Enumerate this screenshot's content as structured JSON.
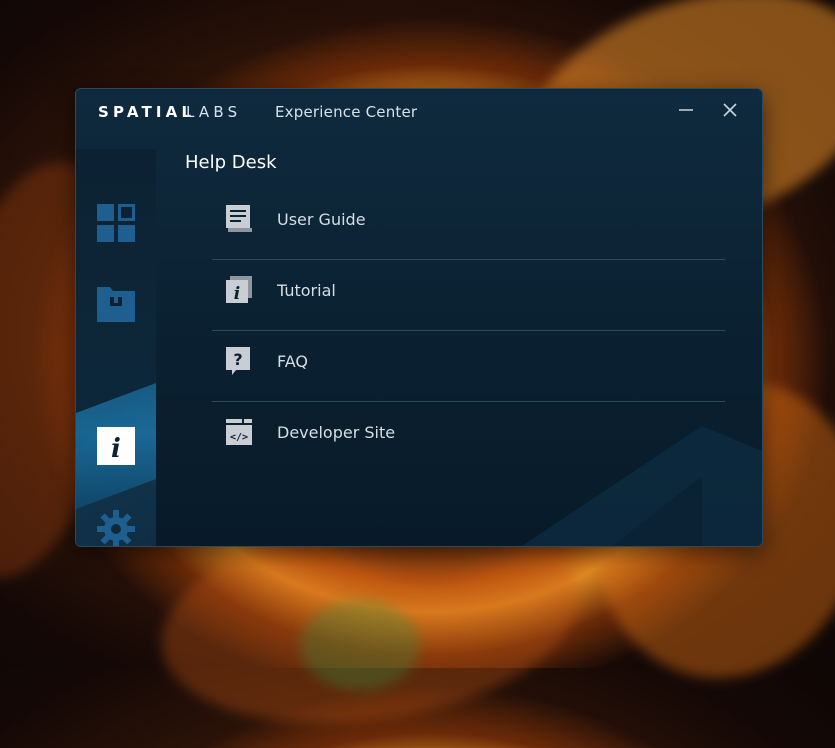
{
  "window": {
    "brand_strong": "SPATIAL",
    "brand_light": "LABS",
    "app_title": "Experience Center",
    "minimize_icon": "minimize-icon",
    "close_icon": "close-icon"
  },
  "sidebar": {
    "items": [
      {
        "icon": "dashboard-grid-icon",
        "active": false
      },
      {
        "icon": "folder-box-icon",
        "active": false
      },
      {
        "icon": "info-icon",
        "active": true
      },
      {
        "icon": "gear-icon",
        "active": false
      }
    ]
  },
  "main": {
    "title": "Help Desk",
    "items": [
      {
        "label": "User Guide",
        "icon": "book-icon"
      },
      {
        "label": "Tutorial",
        "icon": "tutorial-info-icon"
      },
      {
        "label": "FAQ",
        "icon": "question-bubble-icon"
      },
      {
        "label": "Developer Site",
        "icon": "code-window-icon"
      }
    ]
  },
  "colors": {
    "window_bg": "#0b2233",
    "accent": "#1c7ab0",
    "icon_blue": "#1f5f8f",
    "text": "#d6dee4"
  }
}
